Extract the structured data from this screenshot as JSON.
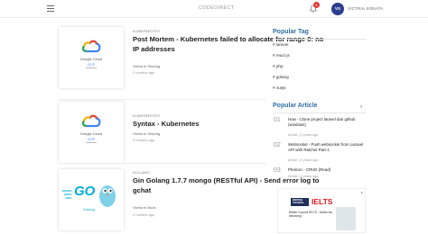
{
  "header": {
    "brand": "CODEDIRECT",
    "notification_count": "6",
    "avatar_initials": "VS",
    "user_name": "VICTRIA SONATA"
  },
  "posts": [
    {
      "category": "KUBERNETES",
      "title": "Post Mortem - Kubernetes failed to allocate for range 0: no IP addresses",
      "author": "Victria in Sharing",
      "time": "2 months ago",
      "thumb_text": "Google Cloud",
      "thumb_sub": "GCP"
    },
    {
      "category": "KUBERNETES",
      "title": "Syntax - Kubernetes",
      "author": "Victria in Sharing",
      "time": "2 months ago",
      "thumb_text": "Google Cloud",
      "thumb_sub": "GCP"
    },
    {
      "category": "GOLANG",
      "title": "Gin Golang 1.7.7 mongo (RESTful API) - Send error log to gchat",
      "author": "Victria in Book",
      "time": "2 months ago",
      "thumb_text": "GO",
      "thumb_sub": "Golang"
    }
  ],
  "sidebar": {
    "popular_tag_title": "Popular Tag",
    "tags": [
      "# laravel",
      "# react js",
      "# php",
      "# golang",
      "# vuejs"
    ],
    "popular_article_title": "Popular Article",
    "more_arrow": "›",
    "articles": [
      {
        "num": "01",
        "title": "How - Clone project laravel dari github (windows)",
        "meta": "Article | 2 years ago"
      },
      {
        "num": "02",
        "title": "Websocket - Push websocket from Laravel API with Ratchet Part-1",
        "meta": "Article | 2 years ago"
      },
      {
        "num": "03",
        "title": "Phalcon - CRUD (Read)",
        "meta": "Article | 2 years ago"
      }
    ]
  },
  "ad": {
    "brand_line": "BRITISH COUNCIL",
    "ielts": "IELTS",
    "body": "British Council IELTS - Daftar tes sekarang"
  },
  "colors": {
    "accent": "#2f6fa8",
    "avatar": "#2c3e8f",
    "badge": "#e53935",
    "go_blue": "#00acd7"
  }
}
